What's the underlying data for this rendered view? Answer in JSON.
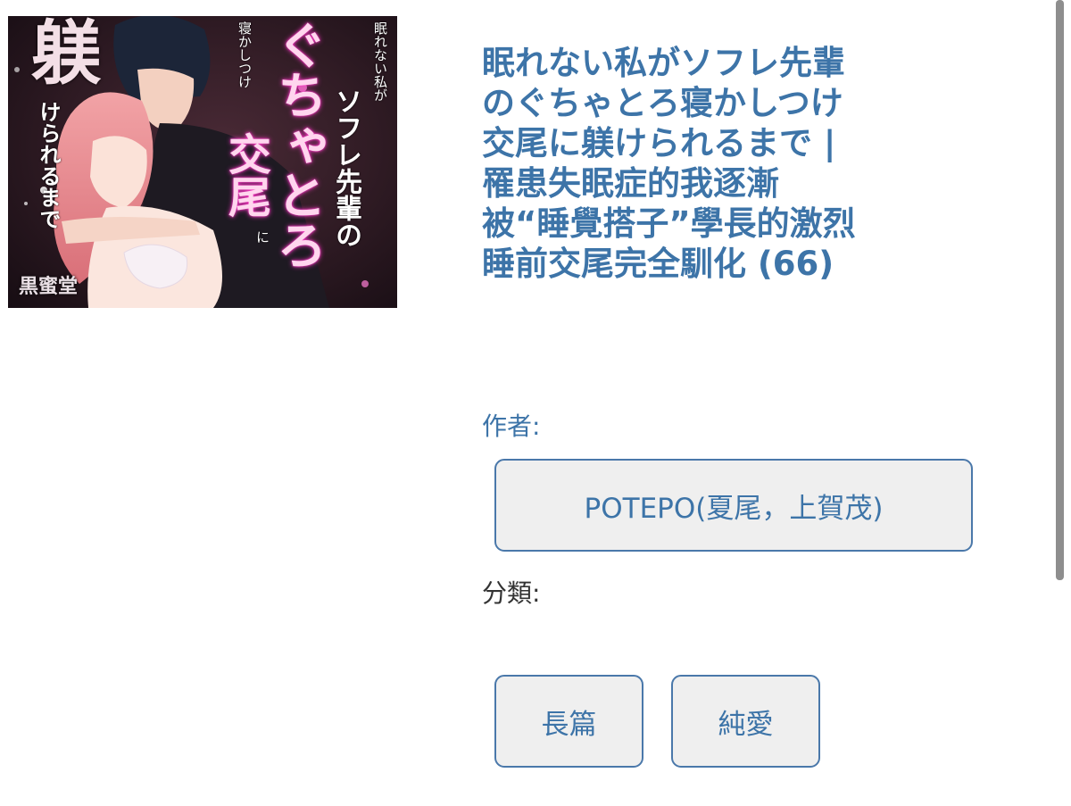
{
  "comic": {
    "cover": {
      "alt_icon": "cover-image",
      "caption_lines": {
        "line1": "眠れない私が",
        "line2": "ソフレ先輩の",
        "line3": "寝かしつけ",
        "line4": "ぐちゃとろ",
        "line5": "交尾",
        "line6": "に",
        "line7": "躾",
        "line8": "けられるまで",
        "brand": "黒蜜堂"
      }
    },
    "title": "眠れない私がソフレ先輩のぐちゃとろ寝かしつけ交尾に躾けられるまで | 罹患失眠症的我逐漸被“睡覺搭子”學長的激烈睡前交尾完全馴化 (66)",
    "author_label": "作者:",
    "author": "POTEPO(夏尾，上賀茂)",
    "category_label": "分類:",
    "tags": [
      "長篇",
      "純愛"
    ]
  },
  "colors": {
    "link": "#3d74a8",
    "button_border": "#4a78aa",
    "button_bg": "#efefef",
    "label_dark": "#333333"
  }
}
